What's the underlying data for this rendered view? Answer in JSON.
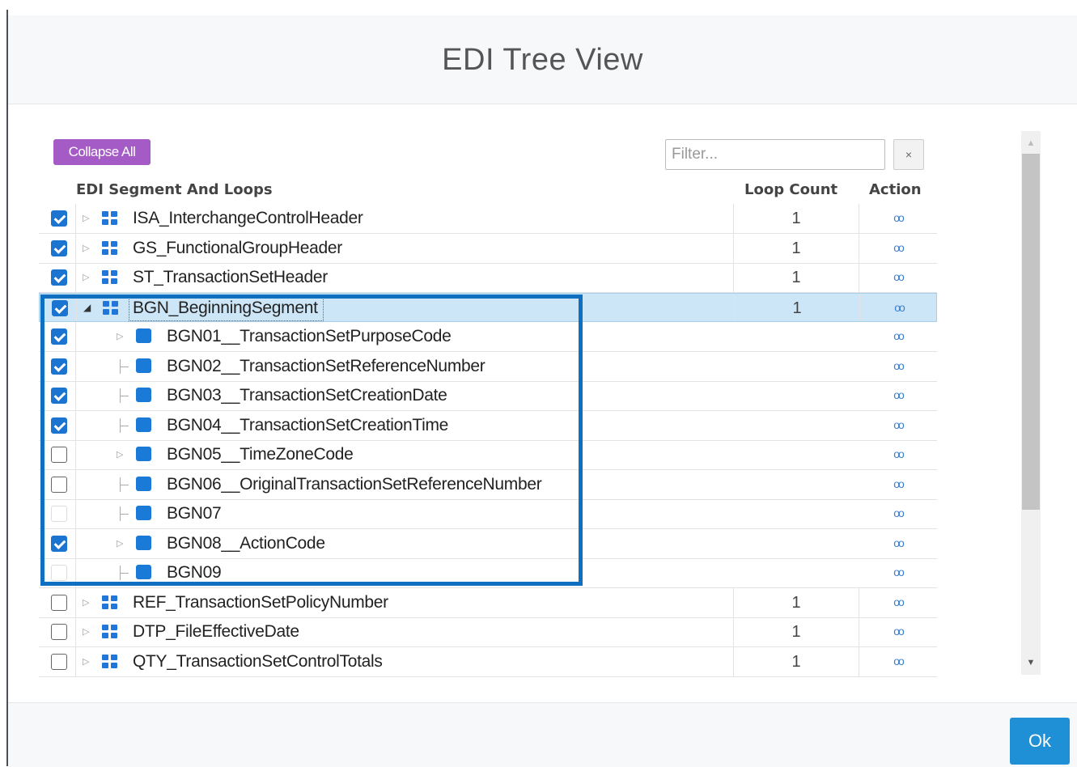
{
  "dialog": {
    "title": "EDI Tree View",
    "ok_label": "Ok",
    "rainbow_colors": [
      "#3a3f4b",
      "#3a3f4b",
      "#9b59b6",
      "#3498db",
      "#5cb85c",
      "#f1c40f",
      "#e67e22",
      "#e74c3c",
      "#c0392b",
      "#e74c3c"
    ]
  },
  "toolbar": {
    "collapse_all_label": "Collapse All",
    "filter_placeholder": "Filter...",
    "clear_label": "×"
  },
  "grid": {
    "columns": {
      "segment": "EDI Segment And Loops",
      "loop_count": "Loop Count",
      "action": "Action"
    },
    "action_glyph": "oo",
    "rows": [
      {
        "label": "ISA_InterchangeControlHeader",
        "level": 0,
        "type": "loop",
        "checkbox": "checked",
        "expander": "collapsed",
        "loop_count": "1"
      },
      {
        "label": "GS_FunctionalGroupHeader",
        "level": 0,
        "type": "loop",
        "checkbox": "checked",
        "expander": "collapsed",
        "loop_count": "1"
      },
      {
        "label": "ST_TransactionSetHeader",
        "level": 0,
        "type": "loop",
        "checkbox": "checked",
        "expander": "collapsed",
        "loop_count": "1"
      },
      {
        "label": "BGN_BeginningSegment",
        "level": 0,
        "type": "loop",
        "checkbox": "checked",
        "expander": "expanded",
        "loop_count": "1",
        "selected": true
      },
      {
        "label": "BGN01__TransactionSetPurposeCode",
        "level": 1,
        "type": "element",
        "checkbox": "checked",
        "expander": "collapsed",
        "loop_count": ""
      },
      {
        "label": "BGN02__TransactionSetReferenceNumber",
        "level": 1,
        "type": "element",
        "checkbox": "checked",
        "expander": "leaf",
        "loop_count": ""
      },
      {
        "label": "BGN03__TransactionSetCreationDate",
        "level": 1,
        "type": "element",
        "checkbox": "checked",
        "expander": "leaf",
        "loop_count": ""
      },
      {
        "label": "BGN04__TransactionSetCreationTime",
        "level": 1,
        "type": "element",
        "checkbox": "checked",
        "expander": "leaf",
        "loop_count": ""
      },
      {
        "label": "BGN05__TimeZoneCode",
        "level": 1,
        "type": "element",
        "checkbox": "unchecked",
        "expander": "collapsed",
        "loop_count": ""
      },
      {
        "label": "BGN06__OriginalTransactionSetReferenceNumber",
        "level": 1,
        "type": "element",
        "checkbox": "unchecked",
        "expander": "leaf",
        "loop_count": ""
      },
      {
        "label": "BGN07",
        "level": 1,
        "type": "element",
        "checkbox": "disabled",
        "expander": "leaf",
        "loop_count": ""
      },
      {
        "label": "BGN08__ActionCode",
        "level": 1,
        "type": "element",
        "checkbox": "checked",
        "expander": "collapsed",
        "loop_count": ""
      },
      {
        "label": "BGN09",
        "level": 1,
        "type": "element",
        "checkbox": "disabled",
        "expander": "leaf",
        "loop_count": ""
      },
      {
        "label": "REF_TransactionSetPolicyNumber",
        "level": 0,
        "type": "loop",
        "checkbox": "unchecked",
        "expander": "collapsed",
        "loop_count": "1"
      },
      {
        "label": "DTP_FileEffectiveDate",
        "level": 0,
        "type": "loop",
        "checkbox": "unchecked",
        "expander": "collapsed",
        "loop_count": "1"
      },
      {
        "label": "QTY_TransactionSetControlTotals",
        "level": 0,
        "type": "loop",
        "checkbox": "unchecked",
        "expander": "collapsed",
        "loop_count": "1"
      }
    ]
  },
  "colors": {
    "accent_blue": "#1a74d0",
    "collapse_purple": "#a45bc6",
    "highlight_border": "#0f6fc0",
    "selected_row": "#cde6f7"
  }
}
